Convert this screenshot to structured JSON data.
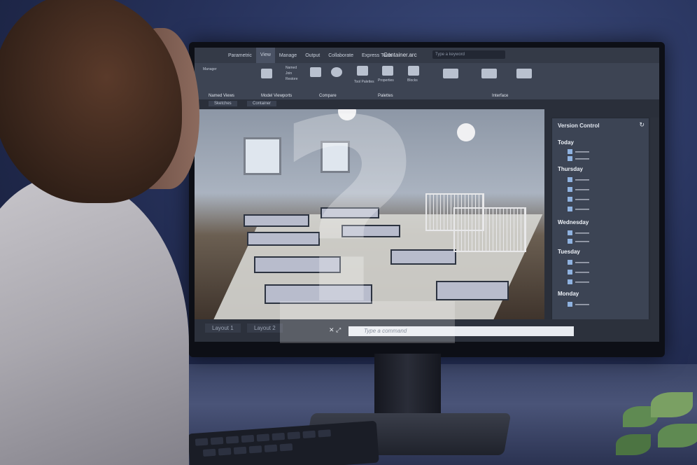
{
  "app": {
    "title": "Container.arc",
    "search_placeholder": "Type a keyword",
    "ribbon_tabs": [
      "Parametric",
      "View",
      "Manage",
      "Output",
      "Collaborate",
      "Express Tools"
    ],
    "active_tab": "View"
  },
  "ribbon": {
    "groups": [
      "Named Views",
      "Model Viewports",
      "Compare",
      "Palettes",
      "Interface"
    ],
    "items": [
      "Manager",
      "Named",
      "Join",
      "Restore",
      "Properties",
      "Blocks",
      "Tool Palettes"
    ]
  },
  "doc_tabs": [
    "Sketches",
    "Container"
  ],
  "command_bar": {
    "layouts": [
      "Layout 1",
      "Layout 2"
    ],
    "command_placeholder": "Type a command"
  },
  "version_control": {
    "title": "Version Control",
    "days": [
      {
        "name": "Today",
        "rows": 2
      },
      {
        "name": "Thursday",
        "rows": 4
      },
      {
        "name": "Wednesday",
        "rows": 2
      },
      {
        "name": "Tuesday",
        "rows": 3
      },
      {
        "name": "Monday",
        "rows": 1
      }
    ]
  },
  "overlay": {
    "glyph": "?"
  }
}
